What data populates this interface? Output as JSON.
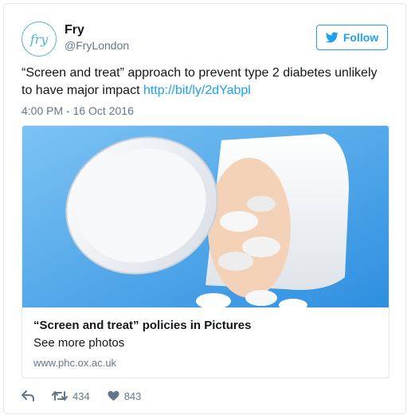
{
  "author": {
    "avatar_text": "fry",
    "name": "Fry",
    "handle": "@FryLondon"
  },
  "follow": {
    "label": "Follow",
    "icon": "bird-icon"
  },
  "tweet": {
    "text": "“Screen and treat” approach to prevent type 2 diabetes unlikely to have major impact ",
    "link": "http://bit/ly/2dYabpl",
    "timestamp": "4:00 PM - 16 Oct 2016"
  },
  "card": {
    "image": "pill-bottle-photo",
    "title": "“Screen and treat” policies in Pictures",
    "description": "See more photos",
    "url": "www.phc.ox.ac.uk"
  },
  "actions": {
    "reply_icon": "reply-icon",
    "retweet_icon": "retweet-icon",
    "retweet_count": "434",
    "like_icon": "heart-icon",
    "like_count": "843"
  },
  "colors": {
    "accent": "#1da1f2",
    "muted": "#657786",
    "border": "#e1e8ed"
  }
}
